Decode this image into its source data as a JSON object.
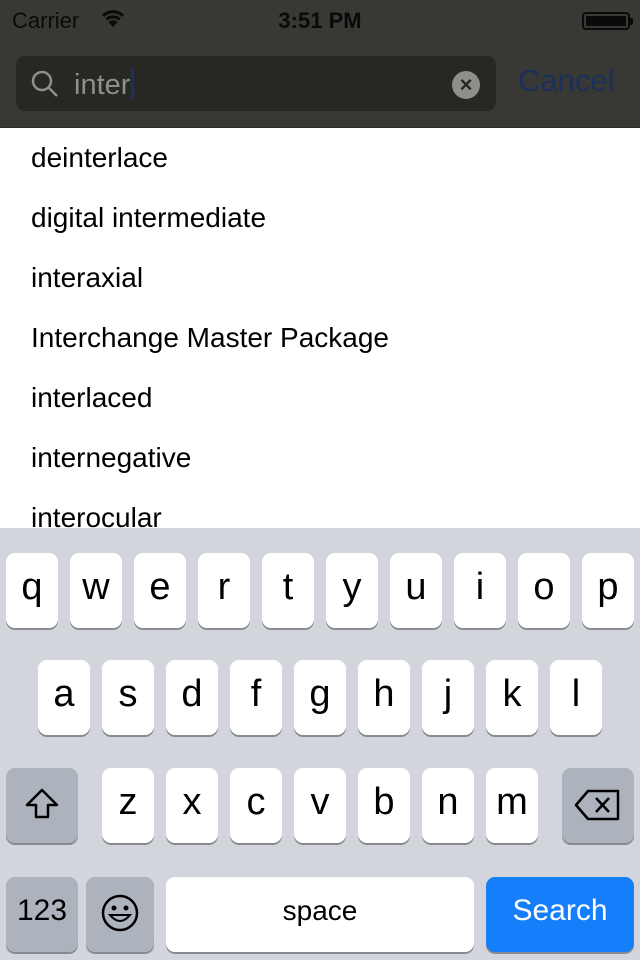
{
  "status_bar": {
    "carrier": "Carrier",
    "time": "3:51 PM",
    "wifi_icon": "wifi-icon",
    "battery_icon": "battery-icon"
  },
  "search": {
    "value": "inter",
    "cancel_label": "Cancel",
    "clear_icon": "clear-icon"
  },
  "results": [
    "deinterlace",
    "digital intermediate",
    "interaxial",
    "Interchange Master Package",
    "interlaced",
    "internegative",
    "interocular"
  ],
  "keyboard": {
    "row1": [
      "q",
      "w",
      "e",
      "r",
      "t",
      "y",
      "u",
      "i",
      "o",
      "p"
    ],
    "row2": [
      "a",
      "s",
      "d",
      "f",
      "g",
      "h",
      "j",
      "k",
      "l"
    ],
    "row3": [
      "z",
      "x",
      "c",
      "v",
      "b",
      "n",
      "m"
    ],
    "numbers_label": "123",
    "space_label": "space",
    "search_label": "Search",
    "accent_color": "#157efb"
  }
}
